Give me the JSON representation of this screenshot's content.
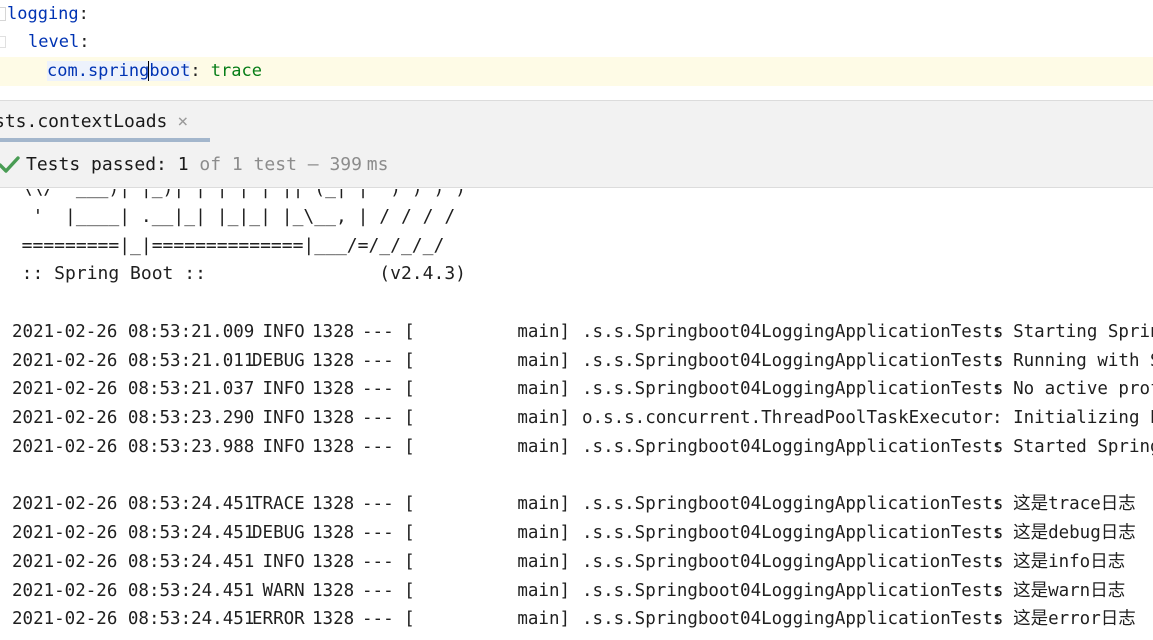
{
  "editor": {
    "lines": [
      {
        "key": "logging",
        "colon": ":",
        "value": ""
      },
      {
        "key": "level",
        "colon": ":",
        "value": ""
      },
      {
        "key_before_caret": "com.spring",
        "key_after_caret": "boot",
        "colon": ": ",
        "value": "trace"
      }
    ]
  },
  "run_window": {
    "tab_label": "sts.contextLoads",
    "tab_close_glyph": "×",
    "status": {
      "passed_label": "Tests passed: ",
      "passed_count": "1",
      "of_text": " of 1 test – 399",
      "ms_unit": " ms"
    }
  },
  "console": {
    "banner": [
      "  \\\\/  ___)| |_)| | | | | || (_| |  ) ) ) )",
      "   '  |____| .__|_| |_|_| |_\\__, | / / / /",
      "  =========|_|==============|___/=/_/_/_/",
      "  :: Spring Boot ::                (v2.4.3)"
    ],
    "log_lines": [
      {
        "ts": "2021-02-26 08:53:21.009",
        "level": " INFO",
        "pid": "1328",
        "sep": "--- [",
        "thread": "          main]",
        "logger": ".s.s.Springboot04LoggingApplicationTests",
        "msg": ": Starting Sprin"
      },
      {
        "ts": "2021-02-26 08:53:21.011",
        "level": "DEBUG",
        "pid": "1328",
        "sep": "--- [",
        "thread": "          main]",
        "logger": ".s.s.Springboot04LoggingApplicationTests",
        "msg": ": Running with S"
      },
      {
        "ts": "2021-02-26 08:53:21.037",
        "level": " INFO",
        "pid": "1328",
        "sep": "--- [",
        "thread": "          main]",
        "logger": ".s.s.Springboot04LoggingApplicationTests",
        "msg": ": No active prof"
      },
      {
        "ts": "2021-02-26 08:53:23.290",
        "level": " INFO",
        "pid": "1328",
        "sep": "--- [",
        "thread": "          main]",
        "logger": "o.s.s.concurrent.ThreadPoolTaskExecutor ",
        "msg": ": Initializing E"
      },
      {
        "ts": "2021-02-26 08:53:23.988",
        "level": " INFO",
        "pid": "1328",
        "sep": "--- [",
        "thread": "          main]",
        "logger": ".s.s.Springboot04LoggingApplicationTests",
        "msg": ": Started Spring"
      },
      {
        "ts": "2021-02-26 08:53:24.451",
        "level": "TRACE",
        "pid": "1328",
        "sep": "--- [",
        "thread": "          main]",
        "logger": ".s.s.Springboot04LoggingApplicationTests",
        "msg": ": 这是trace日志"
      },
      {
        "ts": "2021-02-26 08:53:24.451",
        "level": "DEBUG",
        "pid": "1328",
        "sep": "--- [",
        "thread": "          main]",
        "logger": ".s.s.Springboot04LoggingApplicationTests",
        "msg": ": 这是debug日志"
      },
      {
        "ts": "2021-02-26 08:53:24.451",
        "level": " INFO",
        "pid": "1328",
        "sep": "--- [",
        "thread": "          main]",
        "logger": ".s.s.Springboot04LoggingApplicationTests",
        "msg": ": 这是info日志"
      },
      {
        "ts": "2021-02-26 08:53:24.451",
        "level": " WARN",
        "pid": "1328",
        "sep": "--- [",
        "thread": "          main]",
        "logger": ".s.s.Springboot04LoggingApplicationTests",
        "msg": ": 这是warn日志"
      },
      {
        "ts": "2021-02-26 08:53:24.451",
        "level": "ERROR",
        "pid": "1328",
        "sep": "--- [",
        "thread": "          main]",
        "logger": ".s.s.Springboot04LoggingApplicationTests",
        "msg": ": 这是error日志"
      }
    ]
  },
  "colors": {
    "yaml_key": "#0033b3",
    "yaml_value": "#067d17",
    "current_line": "#fefbe6",
    "pass_check": "#499c54",
    "panel_bg": "#f2f2f2",
    "tab_underline": "#a3b6cc"
  },
  "icons": {
    "status": "check-icon",
    "tab_close": "close-icon"
  }
}
